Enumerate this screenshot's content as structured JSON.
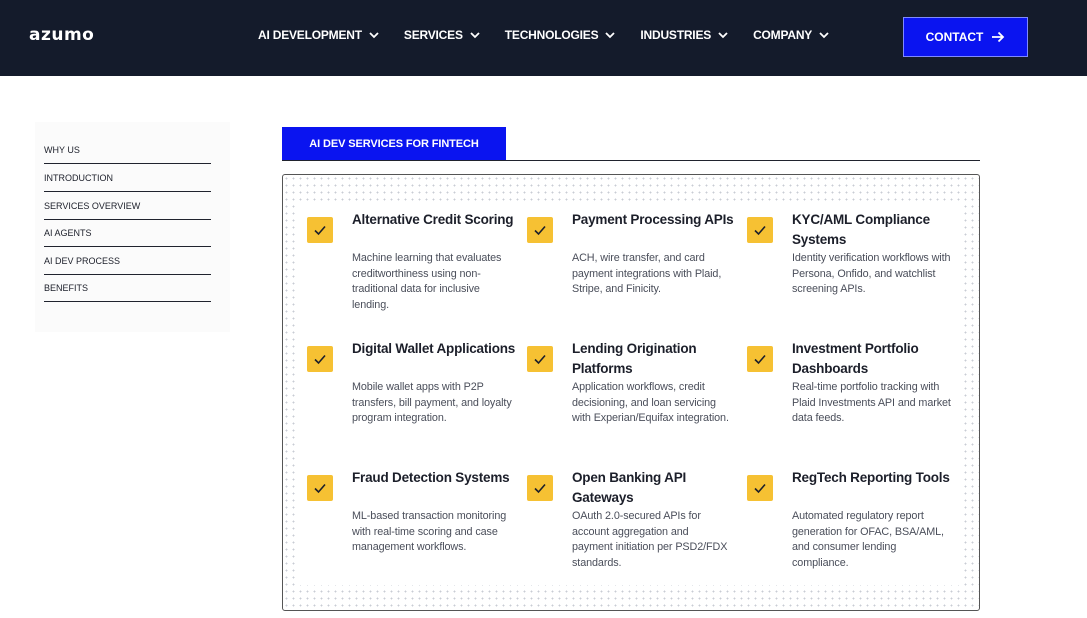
{
  "header": {
    "logo": "azumo",
    "nav": [
      {
        "label": "AI DEVELOPMENT"
      },
      {
        "label": "SERVICES"
      },
      {
        "label": "TECHNOLOGIES"
      },
      {
        "label": "INDUSTRIES"
      },
      {
        "label": "COMPANY"
      }
    ],
    "contact_label": "CONTACT"
  },
  "sidebar": {
    "items": [
      {
        "label": "WHY US"
      },
      {
        "label": "INTRODUCTION"
      },
      {
        "label": "SERVICES OVERVIEW"
      },
      {
        "label": "AI AGENTS"
      },
      {
        "label": "AI DEV PROCESS"
      },
      {
        "label": "BENEFITS"
      }
    ]
  },
  "main": {
    "tab_label": "AI DEV SERVICES FOR FINTECH",
    "services": [
      {
        "title": "Alternative Credit Scoring",
        "description": "Machine learning that evaluates creditworthiness using non-traditional data for inclusive lending."
      },
      {
        "title": "Payment Processing APIs",
        "description": "ACH, wire transfer, and card payment integrations with Plaid, Stripe, and Finicity."
      },
      {
        "title": "KYC/AML Compliance Systems",
        "description": "Identity verification workflows with Persona, Onfido, and watchlist screening APIs."
      },
      {
        "title": "Digital Wallet Applications",
        "description": "Mobile wallet apps with P2P transfers, bill payment, and loyalty program integration."
      },
      {
        "title": "Lending Origination Platforms",
        "description": "Application workflows, credit decisioning, and loan servicing with Experian/Equifax integration."
      },
      {
        "title": "Investment Portfolio Dashboards",
        "description": "Real-time portfolio tracking with Plaid Investments API and market data feeds."
      },
      {
        "title": "Fraud Detection Systems",
        "description": "ML-based transaction monitoring with real-time scoring and case management workflows."
      },
      {
        "title": "Open Banking API Gateways",
        "description": "OAuth 2.0-secured APIs for account aggregation and payment initiation per PSD2/FDX standards."
      },
      {
        "title": "RegTech Reporting Tools",
        "description": "Automated regulatory report generation for OFAC, BSA/AML, and consumer lending compliance."
      }
    ]
  },
  "colors": {
    "header_bg": "#141b2b",
    "accent_blue": "#0a14f0",
    "check_yellow": "#f6c133"
  },
  "icons": [
    "chevron-down-icon",
    "arrow-right-icon",
    "checkmark-icon"
  ]
}
